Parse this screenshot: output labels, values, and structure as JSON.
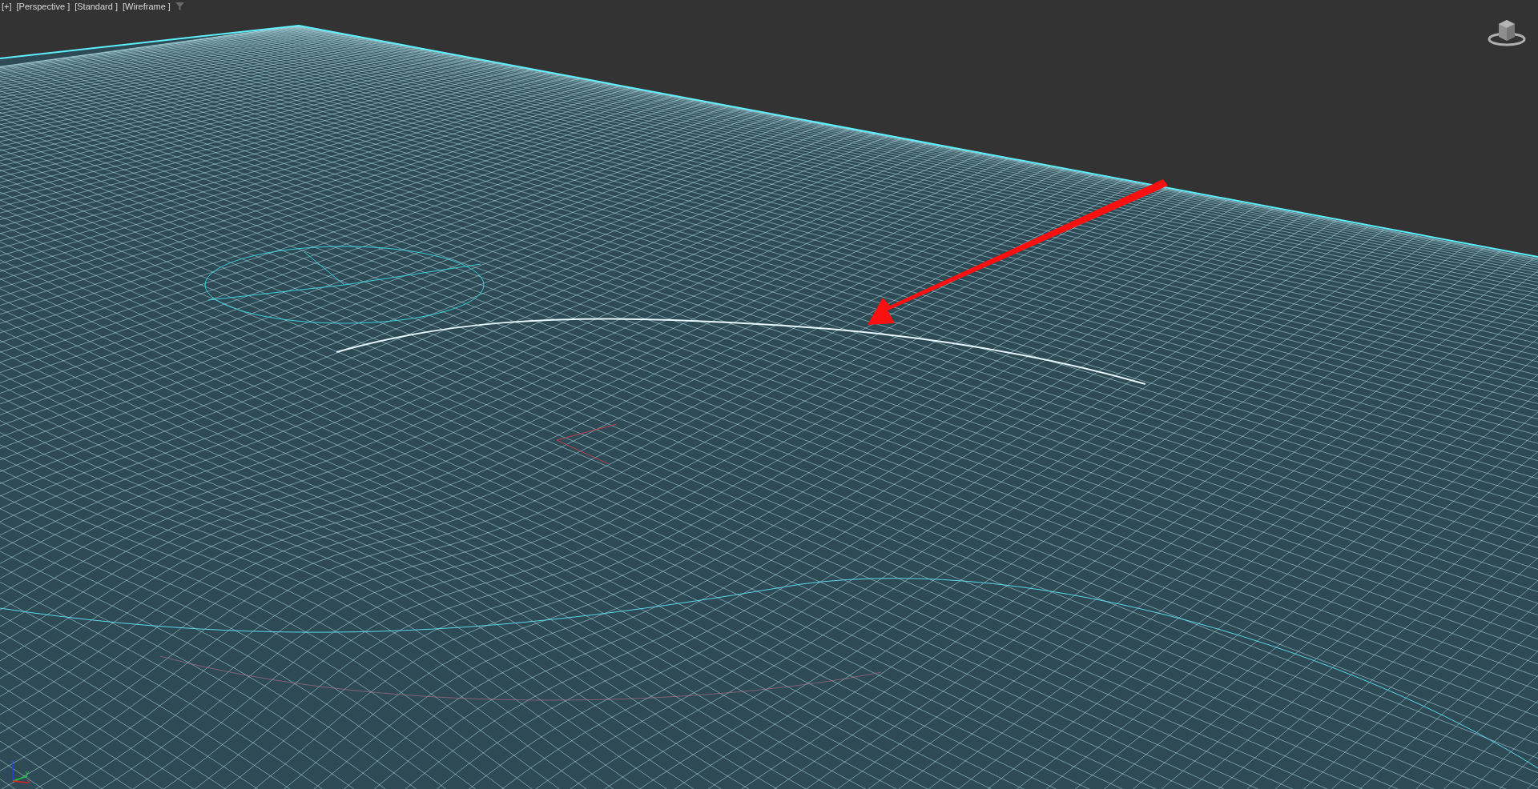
{
  "viewport": {
    "labels": [
      "[+]",
      "[Perspective ]",
      "[Standard ]",
      "[Wireframe ]"
    ],
    "axis_gizmo": {
      "z": "z",
      "y": "y",
      "x": "x"
    }
  }
}
